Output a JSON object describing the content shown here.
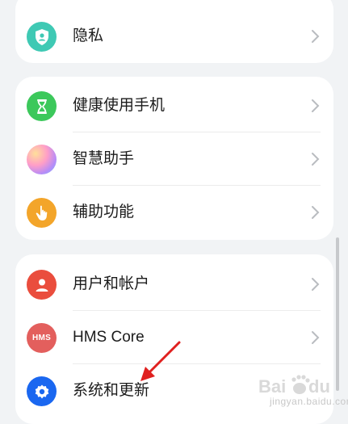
{
  "groups": [
    {
      "items": [
        {
          "label": "隐私",
          "icon": "privacy-shield-icon",
          "color": "#3fc9b4"
        }
      ]
    },
    {
      "items": [
        {
          "label": "健康使用手机",
          "icon": "hourglass-icon",
          "color": "#3cc85b"
        },
        {
          "label": "智慧助手",
          "icon": "assistant-orb-icon",
          "color": "#c990f5"
        },
        {
          "label": "辅助功能",
          "icon": "hand-pointer-icon",
          "color": "#f3a52a"
        }
      ]
    },
    {
      "items": [
        {
          "label": "用户和帐户",
          "icon": "user-icon",
          "color": "#ea4d3d"
        },
        {
          "label": "HMS Core",
          "icon": "hms-icon",
          "icon_text": "HMS",
          "color": "#e35f5d"
        },
        {
          "label": "系统和更新",
          "icon": "gear-icon",
          "color": "#1a67f0"
        }
      ]
    }
  ],
  "watermark": {
    "text": "jingyan.baidu.com"
  },
  "colors": {
    "background": "#f1f3f5",
    "card": "#ffffff",
    "annotation_arrow": "#e0201f"
  }
}
